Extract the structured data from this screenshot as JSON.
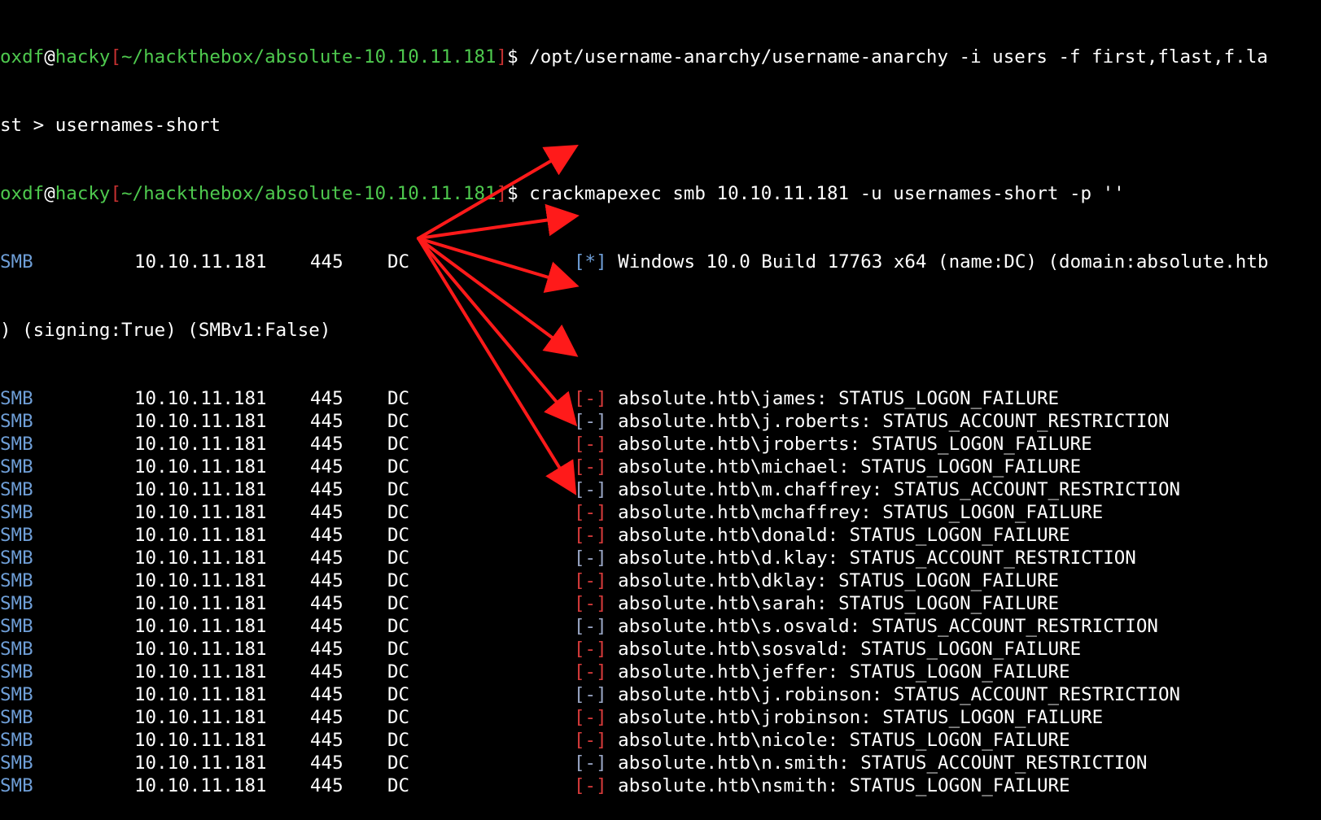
{
  "prompt": {
    "user": "oxdf",
    "at": "@",
    "host": "hacky",
    "bracket_open": "[",
    "path": "~/hackthebox/absolute-10.10.11.181",
    "bracket_close": "]",
    "dollar": "$"
  },
  "commands": [
    {
      "line1": " /opt/username-anarchy/username-anarchy -i users -f first,flast,f.la",
      "line2": "st > usernames-short"
    },
    {
      "line1": " crackmapexec smb 10.10.11.181 -u usernames-short -p ''"
    }
  ],
  "info_line": {
    "proto": "SMB",
    "host": "10.10.11.181",
    "port": "445",
    "name": "DC",
    "marker": "[*]",
    "text": " Windows 10.0 Build 17763 x64 (name:DC) (domain:absolute.htb",
    "continuation": ") (signing:True) (SMBv1:False)"
  },
  "results": [
    {
      "proto": "SMB",
      "host": "10.10.11.181",
      "port": "445",
      "name": "DC",
      "marker": "[-]",
      "kind": "fail",
      "text": " absolute.htb\\james: STATUS_LOGON_FAILURE"
    },
    {
      "proto": "SMB",
      "host": "10.10.11.181",
      "port": "445",
      "name": "DC",
      "marker": "[-]",
      "kind": "restrict",
      "text": " absolute.htb\\j.roberts: STATUS_ACCOUNT_RESTRICTION"
    },
    {
      "proto": "SMB",
      "host": "10.10.11.181",
      "port": "445",
      "name": "DC",
      "marker": "[-]",
      "kind": "fail",
      "text": " absolute.htb\\jroberts: STATUS_LOGON_FAILURE"
    },
    {
      "proto": "SMB",
      "host": "10.10.11.181",
      "port": "445",
      "name": "DC",
      "marker": "[-]",
      "kind": "fail",
      "text": " absolute.htb\\michael: STATUS_LOGON_FAILURE"
    },
    {
      "proto": "SMB",
      "host": "10.10.11.181",
      "port": "445",
      "name": "DC",
      "marker": "[-]",
      "kind": "restrict",
      "text": " absolute.htb\\m.chaffrey: STATUS_ACCOUNT_RESTRICTION"
    },
    {
      "proto": "SMB",
      "host": "10.10.11.181",
      "port": "445",
      "name": "DC",
      "marker": "[-]",
      "kind": "fail",
      "text": " absolute.htb\\mchaffrey: STATUS_LOGON_FAILURE"
    },
    {
      "proto": "SMB",
      "host": "10.10.11.181",
      "port": "445",
      "name": "DC",
      "marker": "[-]",
      "kind": "fail",
      "text": " absolute.htb\\donald: STATUS_LOGON_FAILURE"
    },
    {
      "proto": "SMB",
      "host": "10.10.11.181",
      "port": "445",
      "name": "DC",
      "marker": "[-]",
      "kind": "restrict",
      "text": " absolute.htb\\d.klay: STATUS_ACCOUNT_RESTRICTION"
    },
    {
      "proto": "SMB",
      "host": "10.10.11.181",
      "port": "445",
      "name": "DC",
      "marker": "[-]",
      "kind": "fail",
      "text": " absolute.htb\\dklay: STATUS_LOGON_FAILURE"
    },
    {
      "proto": "SMB",
      "host": "10.10.11.181",
      "port": "445",
      "name": "DC",
      "marker": "[-]",
      "kind": "fail",
      "text": " absolute.htb\\sarah: STATUS_LOGON_FAILURE"
    },
    {
      "proto": "SMB",
      "host": "10.10.11.181",
      "port": "445",
      "name": "DC",
      "marker": "[-]",
      "kind": "restrict",
      "text": " absolute.htb\\s.osvald: STATUS_ACCOUNT_RESTRICTION"
    },
    {
      "proto": "SMB",
      "host": "10.10.11.181",
      "port": "445",
      "name": "DC",
      "marker": "[-]",
      "kind": "fail",
      "text": " absolute.htb\\sosvald: STATUS_LOGON_FAILURE"
    },
    {
      "proto": "SMB",
      "host": "10.10.11.181",
      "port": "445",
      "name": "DC",
      "marker": "[-]",
      "kind": "fail",
      "text": " absolute.htb\\jeffer: STATUS_LOGON_FAILURE"
    },
    {
      "proto": "SMB",
      "host": "10.10.11.181",
      "port": "445",
      "name": "DC",
      "marker": "[-]",
      "kind": "restrict",
      "text": " absolute.htb\\j.robinson: STATUS_ACCOUNT_RESTRICTION"
    },
    {
      "proto": "SMB",
      "host": "10.10.11.181",
      "port": "445",
      "name": "DC",
      "marker": "[-]",
      "kind": "fail",
      "text": " absolute.htb\\jrobinson: STATUS_LOGON_FAILURE"
    },
    {
      "proto": "SMB",
      "host": "10.10.11.181",
      "port": "445",
      "name": "DC",
      "marker": "[-]",
      "kind": "fail",
      "text": " absolute.htb\\nicole: STATUS_LOGON_FAILURE"
    },
    {
      "proto": "SMB",
      "host": "10.10.11.181",
      "port": "445",
      "name": "DC",
      "marker": "[-]",
      "kind": "restrict",
      "text": " absolute.htb\\n.smith: STATUS_ACCOUNT_RESTRICTION"
    },
    {
      "proto": "SMB",
      "host": "10.10.11.181",
      "port": "445",
      "name": "DC",
      "marker": "[-]",
      "kind": "fail",
      "text": " absolute.htb\\nsmith: STATUS_LOGON_FAILURE"
    }
  ],
  "colors": {
    "background": "#000000",
    "prompt_green": "#4ec94e",
    "bracket_red": "#c53030",
    "smb_blue": "#6f9fd8",
    "fail_red": "#d83b3b",
    "restrict_gray": "#9aa7c6",
    "arrow_red": "#ff1a1a"
  },
  "annotation": {
    "type": "arrows",
    "icon": "red-arrow-icon",
    "targets": "account-restriction-rows"
  }
}
